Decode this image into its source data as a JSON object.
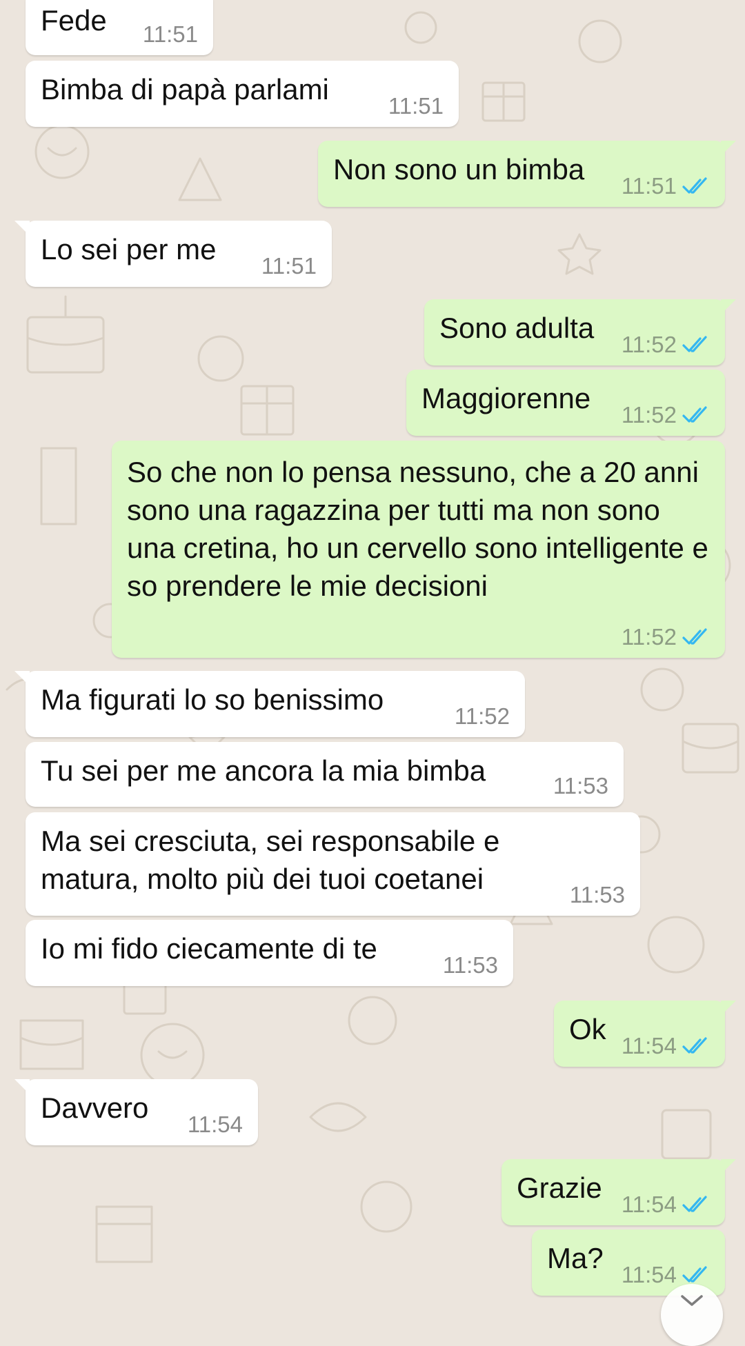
{
  "colors": {
    "wallpaper": "#ece5dd",
    "incoming_bubble": "#ffffff",
    "outgoing_bubble": "#dcf8c6",
    "timestamp_grey": "#8a8a8a",
    "read_ticks": "#34b7f1"
  },
  "messages": [
    {
      "direction": "in",
      "text": "Fede",
      "time": "11:51"
    },
    {
      "direction": "in",
      "text": "Bimba di papà parlami",
      "time": "11:51"
    },
    {
      "direction": "out",
      "text": "Non sono un bimba",
      "time": "11:51",
      "status": "read"
    },
    {
      "direction": "in",
      "text": "Lo sei per me",
      "time": "11:51"
    },
    {
      "direction": "out",
      "text": "Sono adulta",
      "time": "11:52",
      "status": "read"
    },
    {
      "direction": "out",
      "text": "Maggiorenne",
      "time": "11:52",
      "status": "read"
    },
    {
      "direction": "out",
      "text": "So che non lo pensa nessuno, che a 20 anni sono una ragazzina per tutti ma non sono una cretina, ho un cervello sono intelligente e so prendere le mie decisioni",
      "time": "11:52",
      "status": "read"
    },
    {
      "direction": "in",
      "text": "Ma figurati lo so benissimo",
      "time": "11:52"
    },
    {
      "direction": "in",
      "text": "Tu sei per me ancora la mia bimba",
      "time": "11:53"
    },
    {
      "direction": "in",
      "text": "Ma sei cresciuta, sei responsabile e matura, molto più dei tuoi coetanei",
      "time": "11:53"
    },
    {
      "direction": "in",
      "text": "Io mi fido ciecamente di te",
      "time": "11:53"
    },
    {
      "direction": "out",
      "text": "Ok",
      "time": "11:54",
      "status": "read"
    },
    {
      "direction": "in",
      "text": "Davvero",
      "time": "11:54"
    },
    {
      "direction": "out",
      "text": "Grazie",
      "time": "11:54",
      "status": "read"
    },
    {
      "direction": "out",
      "text": "Ma?",
      "time": "11:54",
      "status": "read"
    }
  ],
  "icons": {
    "read_receipt": "double-check-icon",
    "scroll_down": "chevron-down-icon"
  }
}
